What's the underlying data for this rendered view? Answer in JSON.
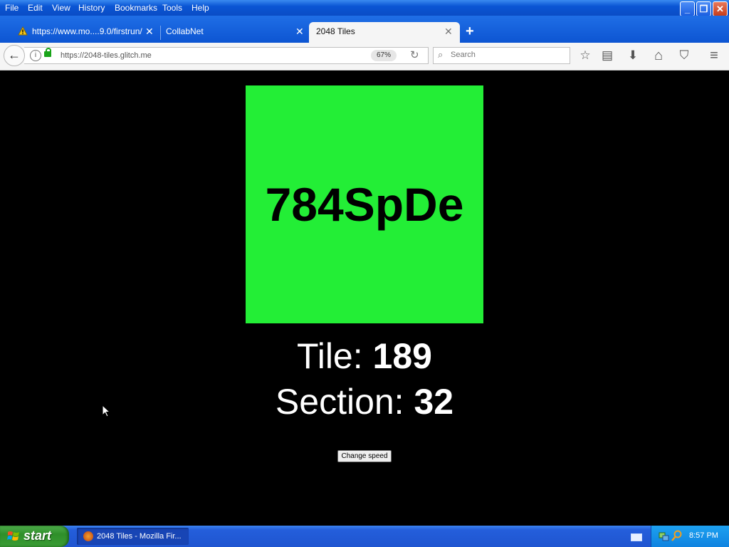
{
  "window": {
    "menus": [
      "File",
      "Edit",
      "View",
      "History",
      "Bookmarks",
      "Tools",
      "Help"
    ],
    "min_label": "_",
    "max_label": "❐",
    "close_label": "✕"
  },
  "tabs": [
    {
      "label": "https://www.mo....9.0/firstrun/",
      "close": "✕"
    },
    {
      "label": "CollabNet",
      "close": "✕"
    },
    {
      "label": "2048 Tiles",
      "close": "✕"
    }
  ],
  "new_tab_label": "+",
  "navbar": {
    "back_icon": "←",
    "url": "https://2048-tiles.glitch.me",
    "zoom": "67%",
    "reload_icon": "↻",
    "search_placeholder": "Search",
    "search_icon": "⌕"
  },
  "toolbar_icons": {
    "bookmark": "☆",
    "reading_list": "▤",
    "download": "⬇",
    "home": "⌂",
    "pocket": "⛉",
    "menu": "≡"
  },
  "page": {
    "tile_text": "784SpDe",
    "tile_color": "#23ee36",
    "tile_label": "Tile: ",
    "tile_value": "189",
    "section_label": "Section: ",
    "section_value": "32",
    "button_label": "Change speed"
  },
  "taskbar": {
    "start_label": "start",
    "task_label": "2048 Tiles - Mozilla Fir...",
    "clock": "8:57 PM"
  }
}
